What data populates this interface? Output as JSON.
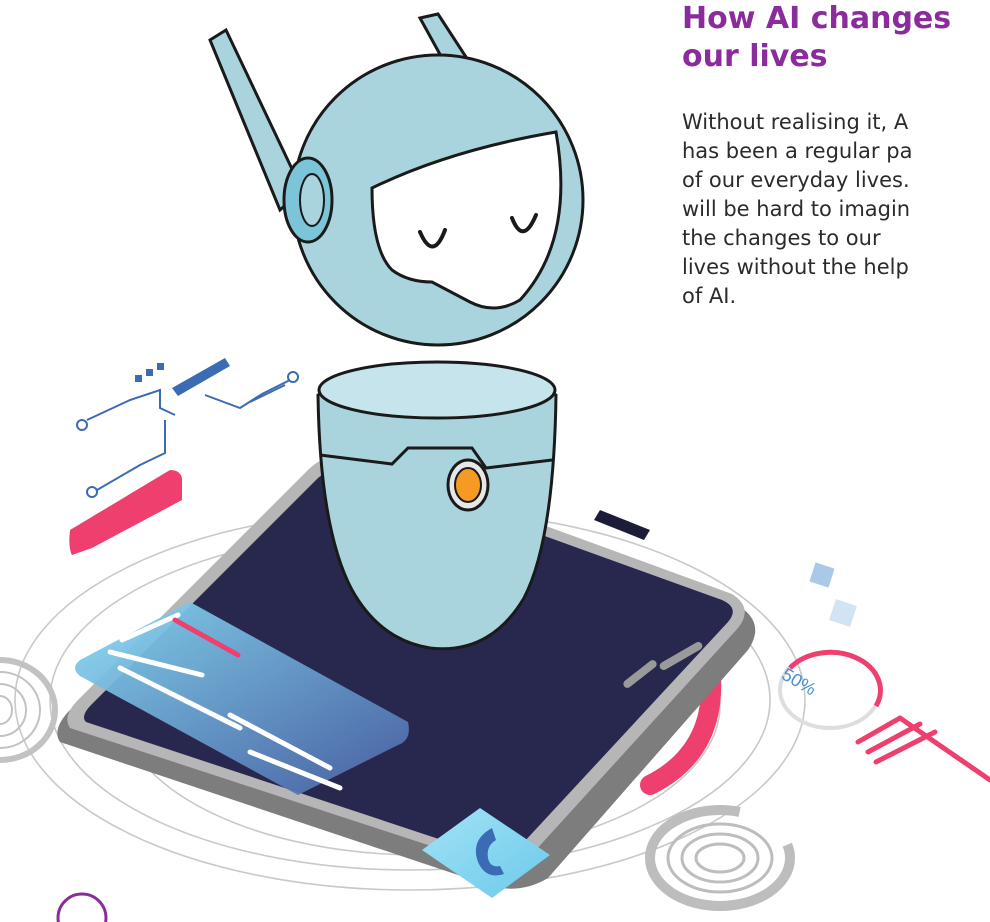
{
  "article": {
    "heading_lines": [
      "How AI changes",
      "our lives"
    ],
    "body_lines": [
      "Without realising it, A",
      "has been a regular pa",
      "of our everyday lives.",
      "will be hard to imagin",
      "the changes to our",
      "lives without the help",
      "of AI."
    ]
  },
  "illustration": {
    "progress_label": "50%",
    "call_icon": "phone-icon",
    "colors": {
      "robot": "#a9d4de",
      "robot_accent": "#7cc4d8",
      "screen": "#28284f",
      "pink": "#ee3f6e",
      "orange": "#f59a23",
      "card_light": "#7fd3f0",
      "card_dark": "#4a65a8",
      "circuit_blue": "#3b6bb5",
      "heading_purple": "#8b2c9c"
    }
  }
}
